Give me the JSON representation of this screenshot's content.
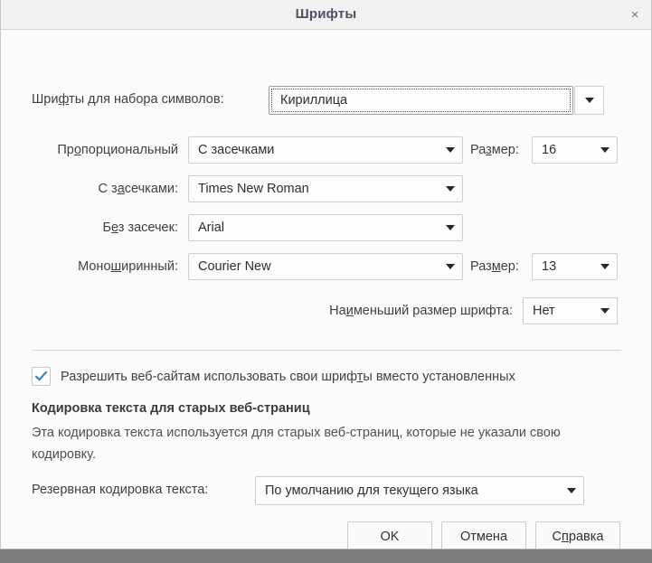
{
  "window": {
    "title": "Шрифты",
    "close_label": "×"
  },
  "form": {
    "charset_label_before": "Шри",
    "charset_label_key": "ф",
    "charset_label_after": "ты для набора символов:",
    "charset_value": "Кириллица",
    "proportional_label_before": "Пр",
    "proportional_label_key": "о",
    "proportional_label_after": "порциональный",
    "proportional_value": "С засечками",
    "prop_size_label_before": "Ра",
    "prop_size_label_key": "з",
    "prop_size_label_after": "мер:",
    "prop_size_value": "16",
    "serif_label_before": "С з",
    "serif_label_key": "а",
    "serif_label_after": "сечками:",
    "serif_value": "Times New Roman",
    "sans_label_before": "Б",
    "sans_label_key": "е",
    "sans_label_after": "з засечек:",
    "sans_value": "Arial",
    "mono_label_before": "Моно",
    "mono_label_key": "ш",
    "mono_label_after": "иринный:",
    "mono_value": "Courier New",
    "mono_size_label_before": "Раз",
    "mono_size_label_key": "м",
    "mono_size_label_after": "ер:",
    "mono_size_value": "13",
    "minsize_label_before": "На",
    "minsize_label_key": "и",
    "minsize_label_after": "меньший размер шрифта:",
    "minsize_value": "Нет",
    "allow_fonts_before": "Разрешить веб-сайтам использовать свои шриф",
    "allow_fonts_key": "т",
    "allow_fonts_after": "ы вместо установленных",
    "allow_fonts_checked": true,
    "encoding_section_title": "Кодировка текста для старых веб-страниц",
    "encoding_section_desc": "Эта кодировка текста используется для старых веб-страниц, которые не указали свою кодировку.",
    "fallback_label": "Резервная кодировка текста:",
    "fallback_value": "По умолчанию для текущего языка"
  },
  "buttons": {
    "ok": "OK",
    "cancel": "Отмена",
    "help_before": "С",
    "help_key": "п",
    "help_after": "равка"
  },
  "colors": {
    "accent": "#2f80c9",
    "title": "#4a5160",
    "dialog_bg": "#fbfbfb",
    "titlebar_bg": "#f1f1f1"
  }
}
